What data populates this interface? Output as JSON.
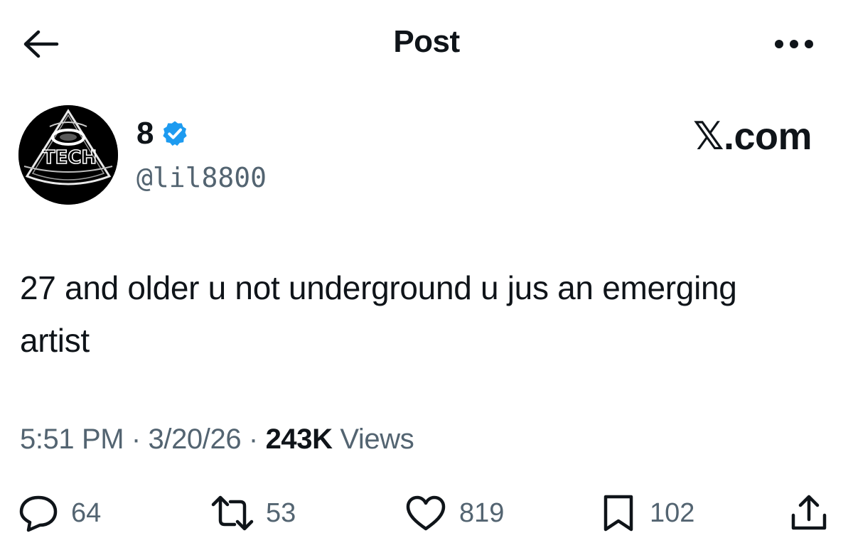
{
  "header": {
    "title": "Post",
    "back_icon": "arrow-left-icon",
    "more_icon": "more-dots-icon"
  },
  "author": {
    "display_name": "8",
    "verified": true,
    "verified_color": "#1d9bf0",
    "handle": "@lil8800",
    "avatar_text": "TECH"
  },
  "brand": {
    "mark": "𝕏",
    "suffix": ".com"
  },
  "post": {
    "text": "27 and older u not underground u jus an emerging artist"
  },
  "meta": {
    "time": "5:51 PM",
    "separator": "·",
    "date": "3/20/26",
    "views_count": "243K",
    "views_label": "Views"
  },
  "actions": {
    "replies": "64",
    "reposts": "53",
    "likes": "819",
    "bookmarks": "102"
  },
  "colors": {
    "text_primary": "#0f1419",
    "text_secondary": "#536471",
    "accent": "#1d9bf0"
  }
}
